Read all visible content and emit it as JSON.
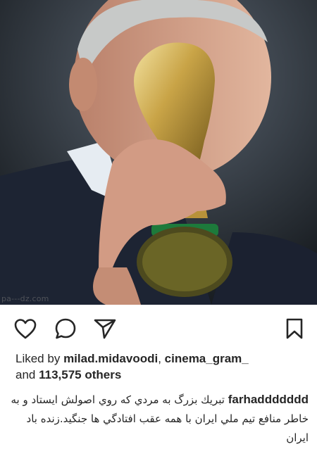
{
  "post": {
    "photo": {
      "alt_icon": "photo-trophy",
      "watermark": "pa---dz.com"
    },
    "actions": {
      "like_icon": "heart-outline-icon",
      "comment_icon": "comment-bubble-icon",
      "share_icon": "paper-plane-icon",
      "save_icon": "bookmark-outline-icon"
    },
    "likes": {
      "prefix": "Liked by",
      "user1": "milad.midavoodi",
      "separator": ",",
      "user2": "cinema_gram_",
      "conjunction": "and",
      "count": "113,575 others"
    },
    "caption": {
      "username": "farhaddddddd",
      "text": "تبريك بزرگ به مردي كه روي اصولش ايستاد و به خاطر منافع تيم ملي ايران با همه عقب افتادگي ها جنگيد.زنده باد ايران"
    }
  }
}
